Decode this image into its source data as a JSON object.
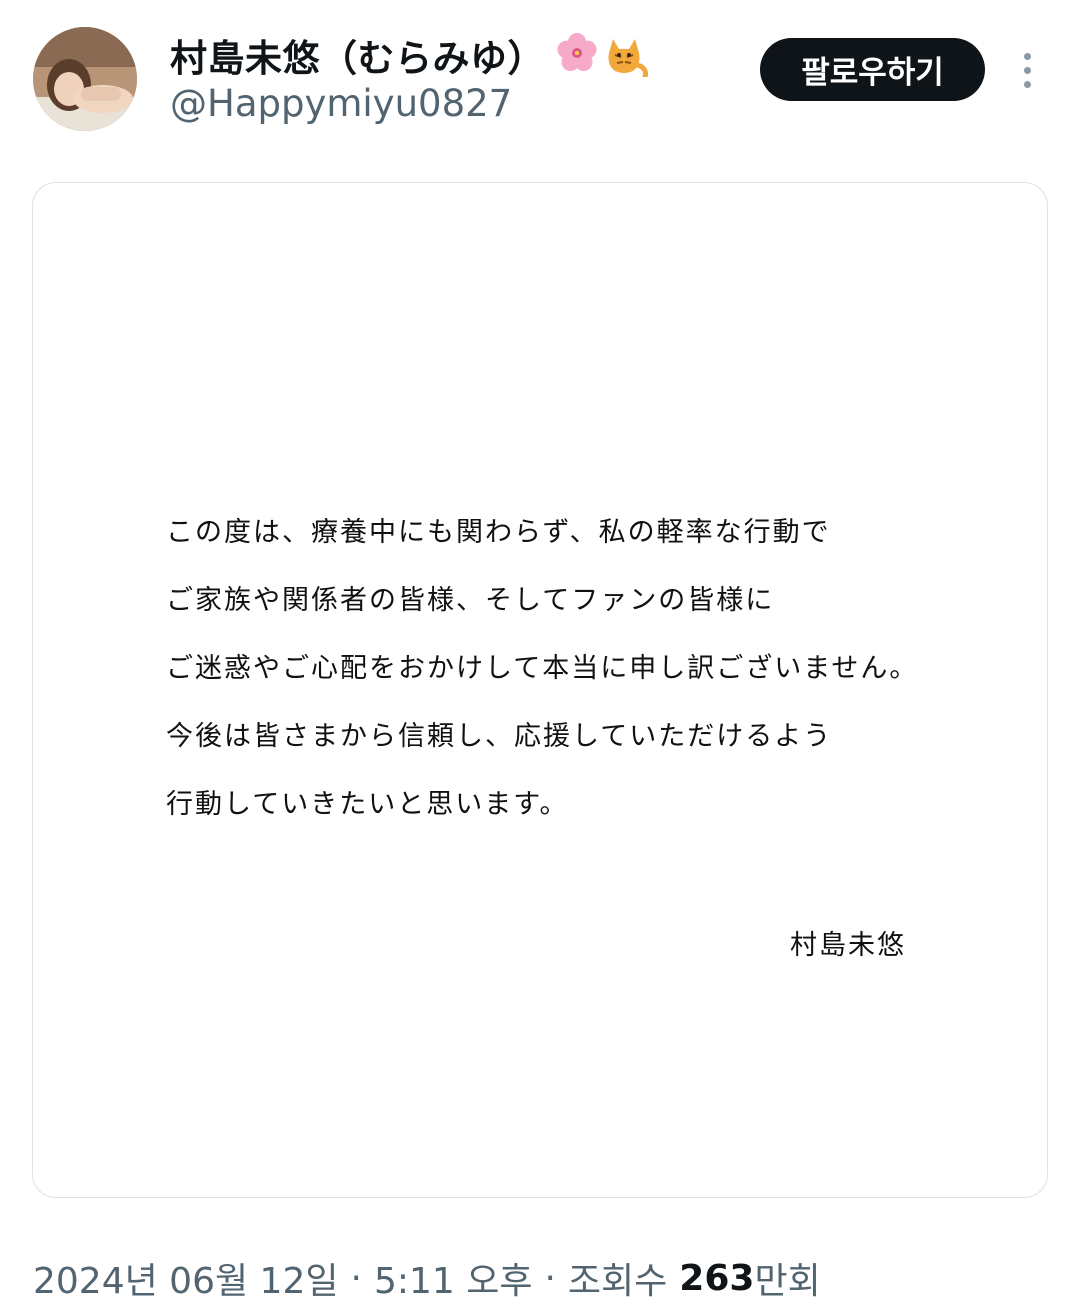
{
  "tweet": {
    "author": {
      "display_name": "村島未悠（むらみゆ）",
      "name_emoji": "🌸🐈",
      "handle": "@Happymiyu0827"
    },
    "follow_label": "팔로우하기",
    "media": {
      "letter_lines": [
        "この度は、療養中にも関わらず、私の軽率な行動で",
        "ご家族や関係者の皆様、そしてファンの皆様に",
        "ご迷惑やご心配をおかけして本当に申し訳ございません。",
        "今後は皆さまから信頼し、応援していただけるよう",
        "行動していきたいと思います。"
      ],
      "signature": "村島未悠"
    },
    "meta": {
      "date": "2024년 06월 12일",
      "separator": "·",
      "time": "5:11 오후",
      "views_label": "조회수",
      "views_count": "263",
      "views_suffix": "만회"
    }
  },
  "icons": {
    "more": "more-vertical-icon"
  },
  "colors": {
    "primary_text": "#0f1419",
    "secondary_text": "#536471",
    "follow_button_bg": "#0f1419",
    "card_border": "#dde1e5"
  }
}
